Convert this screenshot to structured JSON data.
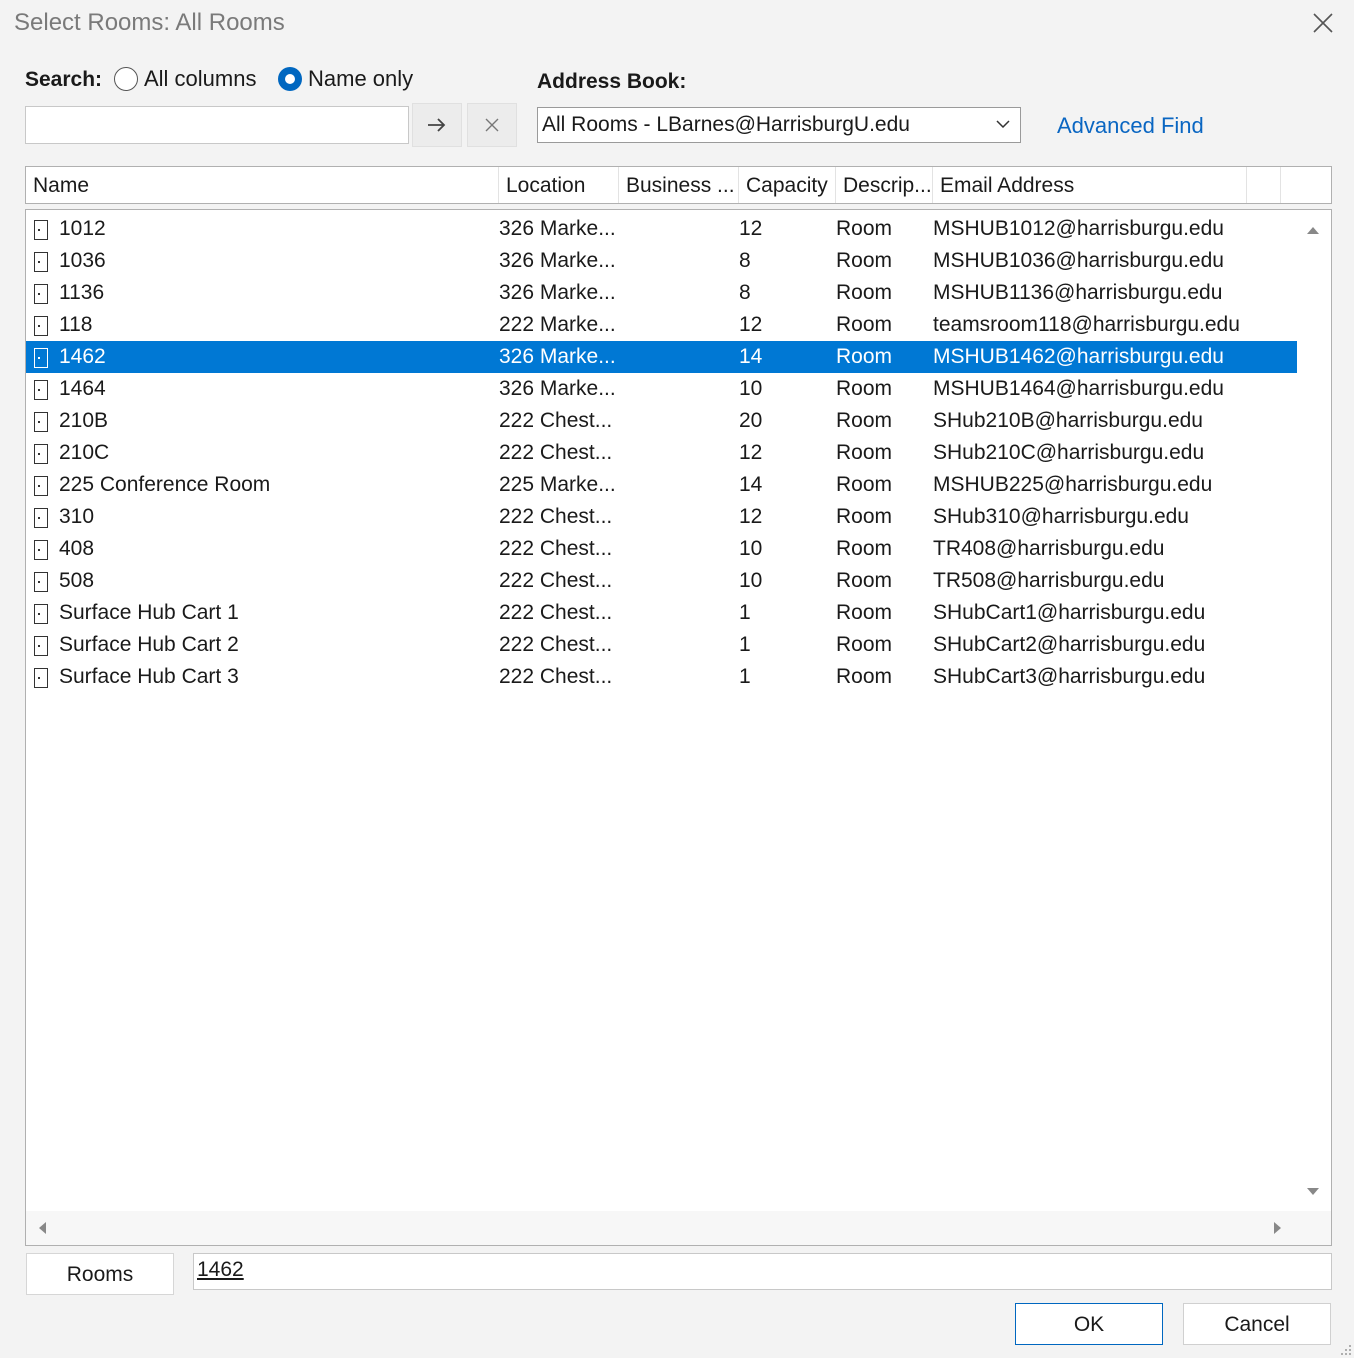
{
  "window": {
    "title": "Select Rooms: All Rooms"
  },
  "search": {
    "label": "Search:",
    "options": [
      "All columns",
      "Name only"
    ],
    "selected_option": "Name only",
    "value": ""
  },
  "address_book": {
    "label": "Address Book:",
    "selected": "All Rooms - LBarnes@HarrisburgU.edu",
    "advanced_find": "Advanced Find"
  },
  "columns": [
    "Name",
    "Location",
    "Business ...",
    "Capacity",
    "Descrip...",
    "Email Address"
  ],
  "rows": [
    {
      "name": "1012",
      "location": "326 Marke...",
      "business": "",
      "capacity": "12",
      "description": "Room",
      "email": "MSHUB1012@harrisburgu.edu"
    },
    {
      "name": "1036",
      "location": "326 Marke...",
      "business": "",
      "capacity": "8",
      "description": "Room",
      "email": "MSHUB1036@harrisburgu.edu"
    },
    {
      "name": "1136",
      "location": "326 Marke...",
      "business": "",
      "capacity": "8",
      "description": "Room",
      "email": "MSHUB1136@harrisburgu.edu"
    },
    {
      "name": "118",
      "location": "222 Marke...",
      "business": "",
      "capacity": "12",
      "description": "Room",
      "email": "teamsroom118@harrisburgu.edu"
    },
    {
      "name": "1462",
      "location": "326 Marke...",
      "business": "",
      "capacity": "14",
      "description": "Room",
      "email": "MSHUB1462@harrisburgu.edu"
    },
    {
      "name": "1464",
      "location": "326 Marke...",
      "business": "",
      "capacity": "10",
      "description": "Room",
      "email": "MSHUB1464@harrisburgu.edu"
    },
    {
      "name": "210B",
      "location": "222 Chest...",
      "business": "",
      "capacity": "20",
      "description": "Room",
      "email": "SHub210B@harrisburgu.edu"
    },
    {
      "name": "210C",
      "location": "222 Chest...",
      "business": "",
      "capacity": "12",
      "description": "Room",
      "email": "SHub210C@harrisburgu.edu"
    },
    {
      "name": "225 Conference Room",
      "location": "225 Marke...",
      "business": "",
      "capacity": "14",
      "description": "Room",
      "email": "MSHUB225@harrisburgu.edu"
    },
    {
      "name": "310",
      "location": "222 Chest...",
      "business": "",
      "capacity": "12",
      "description": "Room",
      "email": "SHub310@harrisburgu.edu"
    },
    {
      "name": "408",
      "location": "222 Chest...",
      "business": "",
      "capacity": "10",
      "description": "Room",
      "email": "TR408@harrisburgu.edu"
    },
    {
      "name": "508",
      "location": "222 Chest...",
      "business": "",
      "capacity": "10",
      "description": "Room",
      "email": "TR508@harrisburgu.edu"
    },
    {
      "name": "Surface Hub Cart 1",
      "location": "222 Chest...",
      "business": "",
      "capacity": "1",
      "description": "Room",
      "email": "SHubCart1@harrisburgu.edu"
    },
    {
      "name": "Surface Hub Cart 2",
      "location": "222 Chest...",
      "business": "",
      "capacity": "1",
      "description": "Room",
      "email": "SHubCart2@harrisburgu.edu"
    },
    {
      "name": "Surface Hub Cart 3",
      "location": "222 Chest...",
      "business": "",
      "capacity": "1",
      "description": "Room",
      "email": "SHubCart3@harrisburgu.edu"
    }
  ],
  "selected_row": "1462",
  "footer": {
    "rooms_button": "Rooms",
    "rooms_value": "1462",
    "ok": "OK",
    "cancel": "Cancel"
  },
  "colors": {
    "accent": "#0078d4",
    "link": "#0a66c2"
  }
}
